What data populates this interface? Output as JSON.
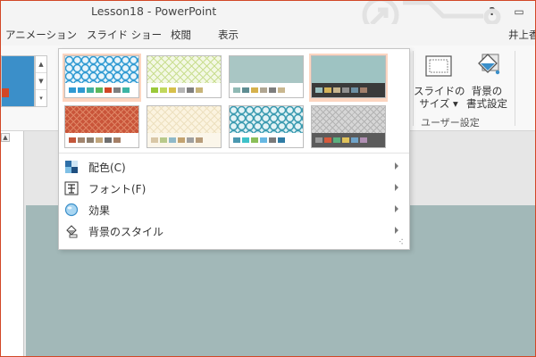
{
  "window": {
    "title": "Lesson18 - PowerPoint",
    "help_label": "?",
    "restore_label": "▭",
    "accent_color": "#d24726"
  },
  "tabs": [
    {
      "label": "アニメーション"
    },
    {
      "label": "スライド ショー"
    },
    {
      "label": "校閲"
    },
    {
      "label": "表示"
    }
  ],
  "user": {
    "name": "井上香"
  },
  "ribbon": {
    "slide_size": {
      "line1": "スライドの",
      "line2": "サイズ ▾",
      "icon": "slide-size-icon"
    },
    "bg_format": {
      "line1": "背景の",
      "line2": "書式設定",
      "icon": "bucket-icon"
    },
    "group_label": "ユーザー設定",
    "gallery_scroll": [
      "▲",
      "▼",
      "▾"
    ]
  },
  "variants": [
    {
      "pattern": "blue-rings",
      "colors": [
        "#2f9ad2",
        "#2f9ad2",
        "#41b0a0",
        "#5cb85c",
        "#d24726",
        "#7f7f7f",
        "#3cb4a4"
      ],
      "selected": true
    },
    {
      "pattern": "green-lattice",
      "colors": [
        "#9ac93a",
        "#c1d85c",
        "#d7c04a",
        "#b5b5b5",
        "#7f7f7f",
        "#c7b478"
      ],
      "selected": false
    },
    {
      "pattern": "plain-teal",
      "colors": [
        "#8fb9b4",
        "#5e8d92",
        "#d6b14c",
        "#b0a692",
        "#7d7d7d",
        "#c9b78f"
      ],
      "selected": false
    },
    {
      "pattern": "dark-teal",
      "colors": [
        "#99bfbf",
        "#d5b45a",
        "#c7b58e",
        "#8f8f8f",
        "#6d8fa3",
        "#a27f6b"
      ],
      "selected": true
    },
    {
      "pattern": "rust-lattice",
      "colors": [
        "#c3563a",
        "#a2856e",
        "#8d7f6f",
        "#c1a67c",
        "#6f6f6f",
        "#a57f66"
      ],
      "selected": false
    },
    {
      "pattern": "cream-lattice",
      "colors": [
        "#d9c7a6",
        "#b8c98a",
        "#8fb9c9",
        "#c3a370",
        "#9f9f9f",
        "#b79c7a"
      ],
      "selected": false
    },
    {
      "pattern": "teal-rings",
      "colors": [
        "#4a98b0",
        "#3ec2c9",
        "#8bbf59",
        "#67b8e3",
        "#7a7a7a",
        "#2f7ca5"
      ],
      "selected": false
    },
    {
      "pattern": "gray-lattice",
      "colors": [
        "#9a9a9a",
        "#d65a3c",
        "#5bb07e",
        "#e0c25a",
        "#6fa3c9",
        "#b08fb3"
      ],
      "selected": false
    }
  ],
  "menu": [
    {
      "label": "配色(C)",
      "icon": "color-scheme-icon"
    },
    {
      "label": "フォント(F)",
      "icon": "font-icon"
    },
    {
      "label": "効果",
      "icon": "effects-icon"
    },
    {
      "label": "背景のスタイル",
      "icon": "background-style-icon"
    }
  ],
  "resize_grip": "⠪"
}
